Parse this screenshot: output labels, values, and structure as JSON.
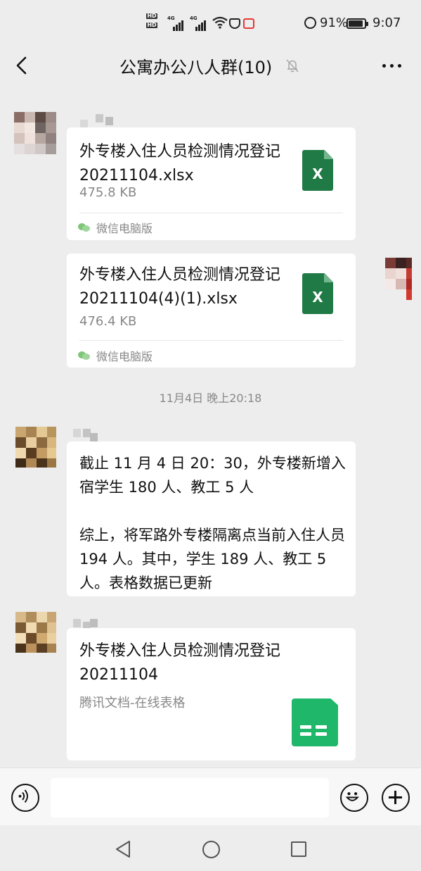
{
  "status_bar": {
    "hd1": "HD",
    "hd2": "HD",
    "net1": "4G",
    "net2": "4G",
    "battery": "91%",
    "battery_level": 0.91,
    "time": "9:07"
  },
  "header": {
    "title": "公寓办公八人群(10)",
    "back_icon": "chevron-left-icon",
    "mute_icon": "bell-off-icon",
    "more_icon": "ellipsis-icon"
  },
  "messages": [
    {
      "type": "file",
      "file_name": "外专楼入住人员检测情况登记 20211104.xlsx",
      "file_size": "475.8 KB",
      "source": "微信电脑版",
      "icon": "excel-file-icon",
      "icon_label": "X"
    },
    {
      "type": "file",
      "file_name": "外专楼入住人员检测情况登记 20211104(4)(1).xlsx",
      "file_size": "476.4 KB",
      "source": "微信电脑版",
      "icon": "excel-file-icon",
      "icon_label": "X"
    },
    {
      "type": "time",
      "text": "11月4日 晚上20:18"
    },
    {
      "type": "text",
      "paragraph1": "截止 11 月 4 日 20：30，外专楼新增入宿学生 180 人、教工 5 人",
      "paragraph2": "综上，将军路外专楼隔离点当前入住人员 194 人。其中，学生 189 人、教工 5 人。表格数据已更新"
    },
    {
      "type": "doc",
      "title": "外专楼入住人员检测情况登记 20211104",
      "source": "腾讯文档-在线表格",
      "icon": "spreadsheet-icon"
    }
  ],
  "input_bar": {
    "voice_icon": "voice-icon",
    "emoji_icon": "emoji-icon",
    "plus_icon": "plus-icon",
    "placeholder": ""
  },
  "nav_bar": {
    "back_icon": "triangle-back-icon",
    "home_icon": "circle-home-icon",
    "recent_icon": "square-recent-icon"
  },
  "colors": {
    "background": "#ededed",
    "bubble": "#ffffff",
    "excel_green": "#1f7a45",
    "sheet_green": "#1fb86a",
    "muted_text": "#888888"
  }
}
